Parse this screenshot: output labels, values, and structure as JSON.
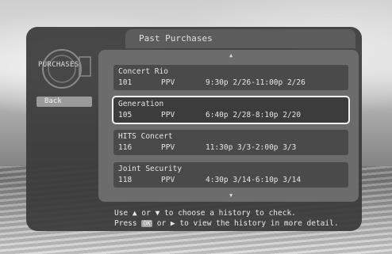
{
  "header": {
    "title": "Past Purchases"
  },
  "logo": {
    "text": "PURCHASES"
  },
  "sidebar": {
    "back_label": "Back"
  },
  "list": {
    "up_arrow": "▲",
    "down_arrow": "▼",
    "items": [
      {
        "name": "Concert Rio",
        "channel": "101",
        "type": "PPV",
        "time": "9:30p 2/26-11:00p 2/26",
        "selected": false
      },
      {
        "name": "Generation",
        "channel": "105",
        "type": "PPV",
        "time": "6:40p 2/28-8:10p 2/20",
        "selected": true
      },
      {
        "name": "HITS Concert",
        "channel": "116",
        "type": "PPV",
        "time": "11:30p 3/3-2:00p 3/3",
        "selected": false
      },
      {
        "name": "Joint Security",
        "channel": "118",
        "type": "PPV",
        "time": "4:30p 3/14-6:10p 3/14",
        "selected": false
      }
    ]
  },
  "help": {
    "line1_prefix": "Use",
    "line1_up": "▲",
    "line1_or": "or",
    "line1_down": "▼",
    "line1_suffix": "to choose a history to check.",
    "line2_prefix": "Press",
    "line2_ok": "OK",
    "line2_or": "or",
    "line2_right": "▶",
    "line2_suffix": "to view the history in more detail."
  }
}
